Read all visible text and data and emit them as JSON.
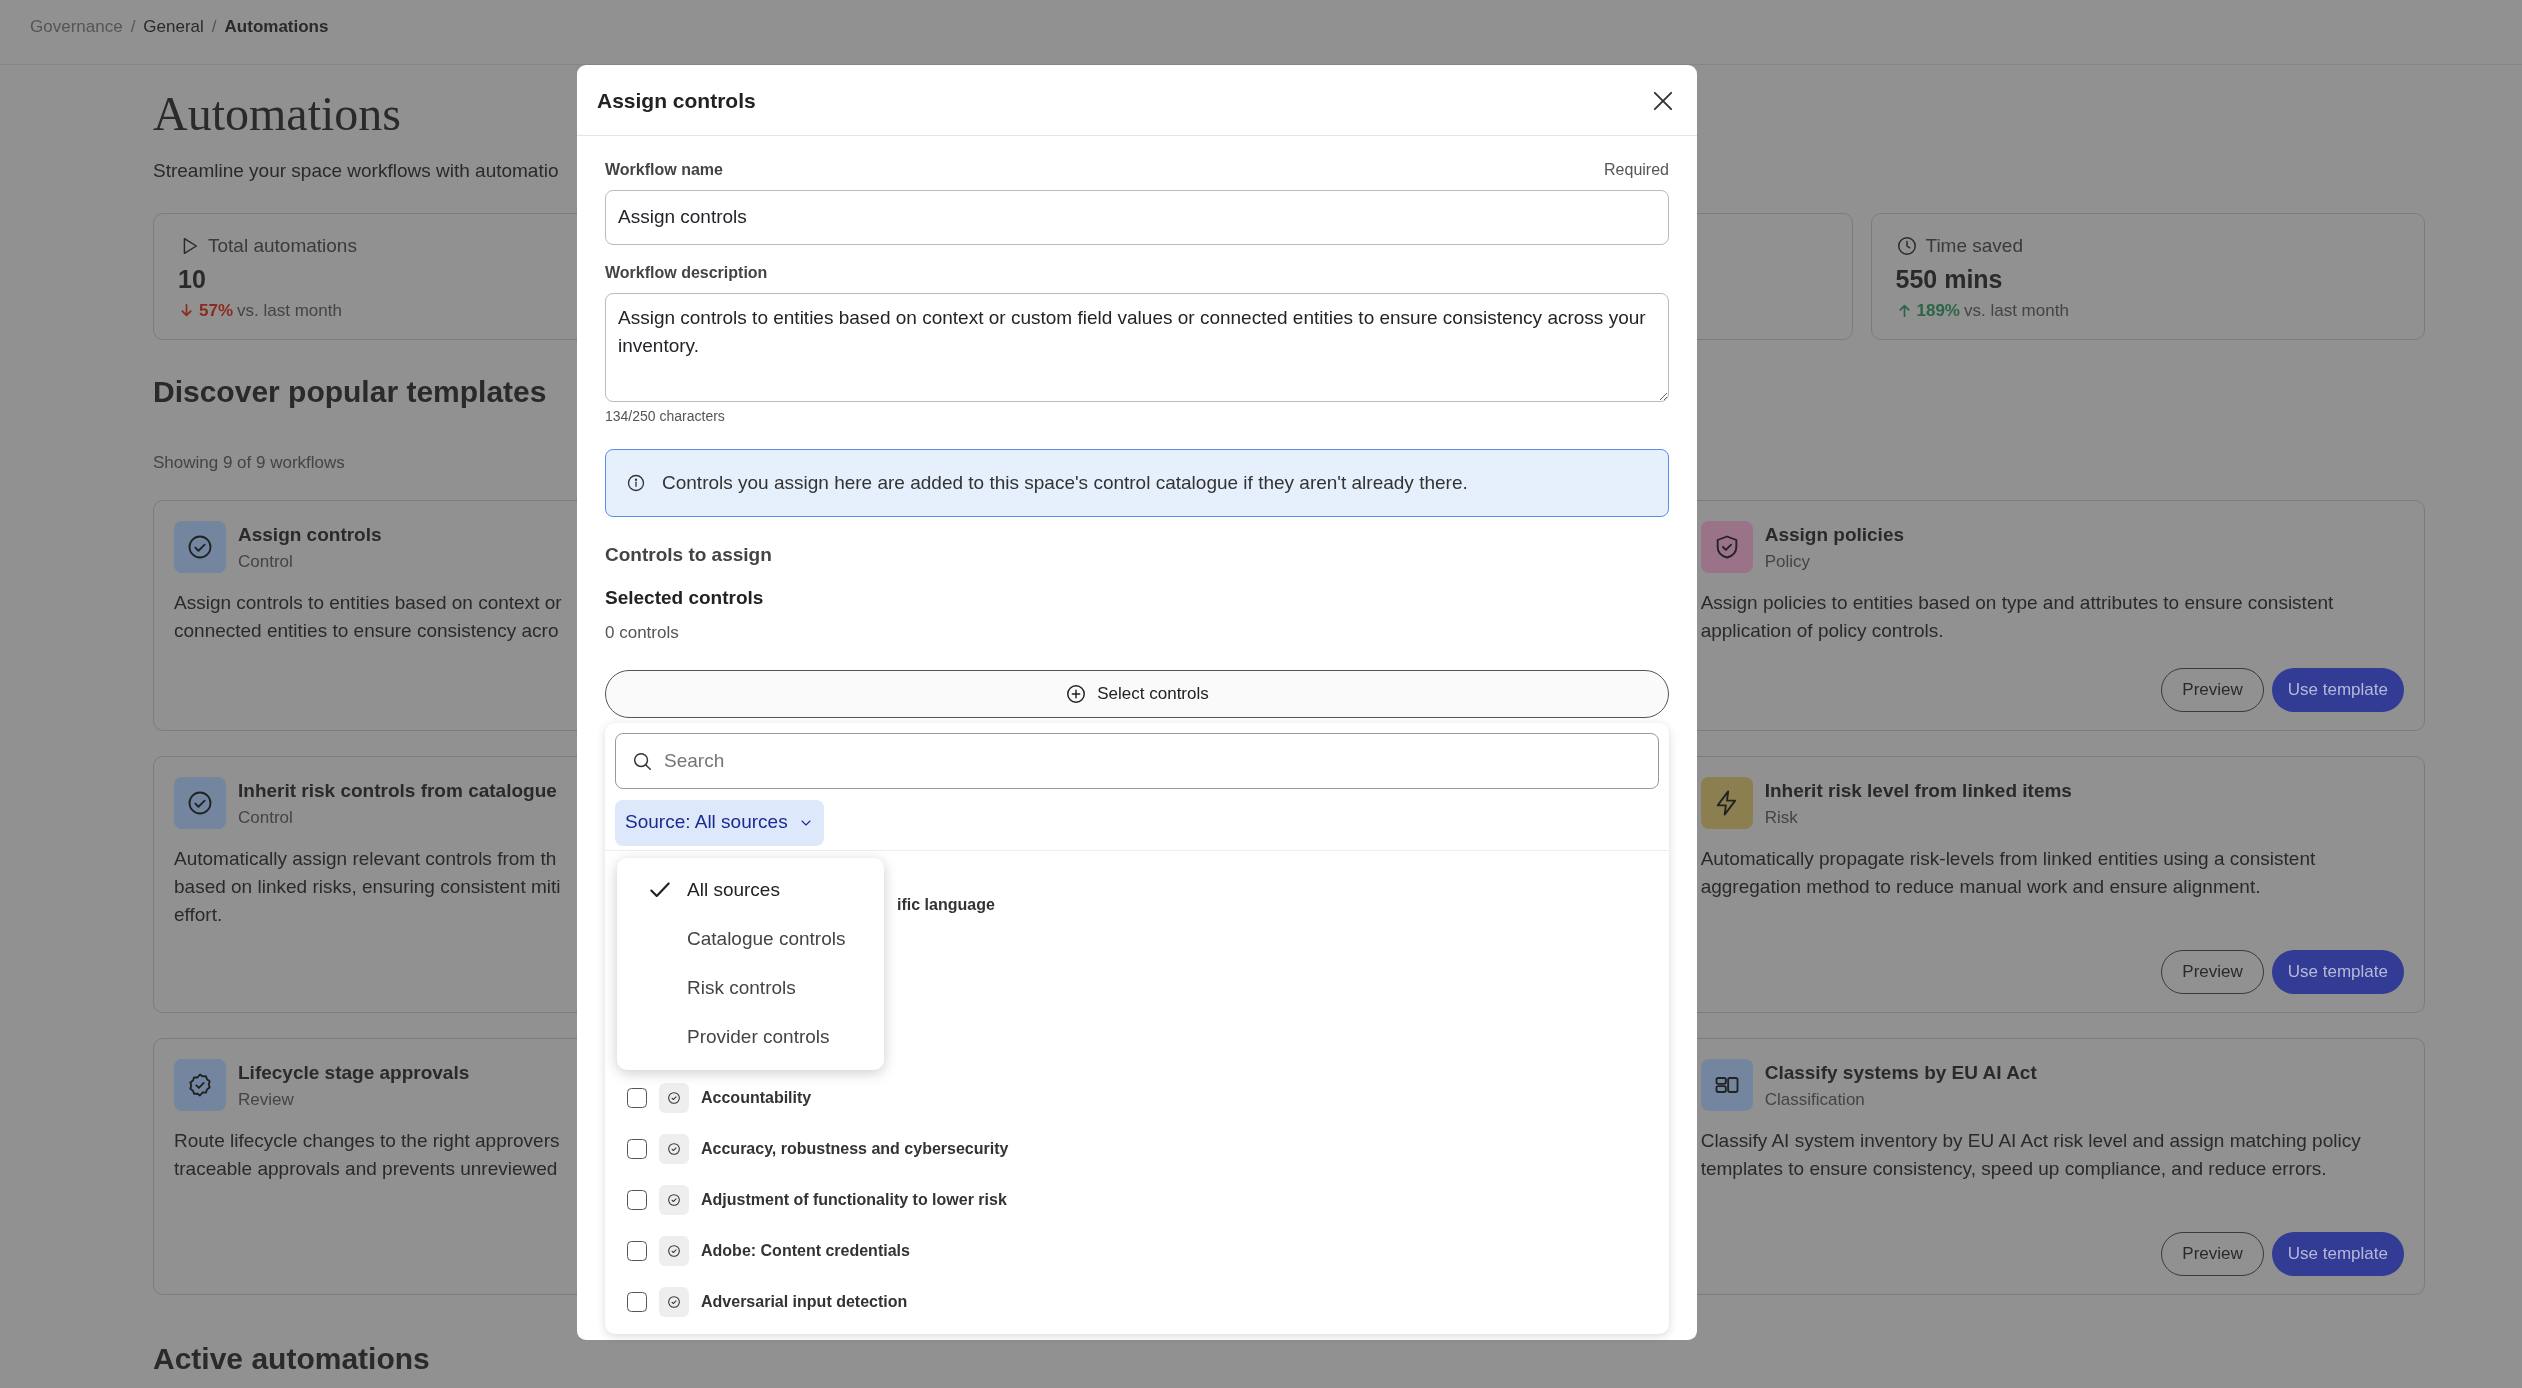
{
  "breadcrumb": [
    {
      "label": "Governance",
      "separator": "/",
      "muted": true,
      "current": false
    },
    {
      "label": "General",
      "separator": "/",
      "muted": false,
      "current": false
    },
    {
      "label": "Automations",
      "muted": false,
      "current": true
    }
  ],
  "page": {
    "title": "Automations",
    "subtitle": "Streamline your space workflows with automatio"
  },
  "stats": [
    {
      "kind": "count",
      "label": "Total automations",
      "value": "10",
      "increase": false,
      "change": "57%",
      "comparison": "vs. last month"
    },
    {
      "kind": "time",
      "label": "Time saved",
      "value": "550 mins",
      "increase": true,
      "change": "189%",
      "comparison": "vs. last month"
    }
  ],
  "templates": {
    "title": "Discover popular templates",
    "count": "Showing 9 of 9 workflows",
    "left_cards": [
      {
        "kind": "control",
        "color": "#74869f",
        "title": "Assign controls",
        "category": "Control",
        "description_lines": [
          "Assign controls to entities based on context or",
          "connected entities to ensure consistency acro"
        ]
      },
      {
        "kind": "control",
        "color": "#74869f",
        "title": "Inherit risk controls from catalogue",
        "category": "Control",
        "description_lines": [
          "Automatically assign relevant controls from th",
          "based on linked risks, ensuring consistent miti",
          "effort."
        ]
      },
      {
        "kind": "review",
        "color": "#74869f",
        "title": "Lifecycle stage approvals",
        "category": "Review",
        "description_lines": [
          "Route lifecycle changes to the right approvers",
          "traceable approvals and prevents unreviewed"
        ]
      }
    ],
    "right_cards": [
      {
        "kind": "policy",
        "color": "#9a7388",
        "title": "Assign policies",
        "category": "Policy",
        "description_lines": [
          "Assign policies to entities based on type and attributes to ensure consistent application of policy controls."
        ],
        "buttons": [
          "Preview",
          "Use template"
        ]
      },
      {
        "kind": "risk",
        "color": "#8b7f4f",
        "title": "Inherit risk level from linked items",
        "category": "Risk",
        "description_lines": [
          "Automatically propagate risk-levels from linked entities using a consistent aggregation method to reduce manual work and ensure alignment."
        ],
        "buttons": [
          "Preview",
          "Use template"
        ]
      },
      {
        "kind": "classification",
        "color": "#74869f",
        "title": "Classify systems by EU AI Act",
        "category": "Classification",
        "description_lines": [
          "Classify AI system inventory by EU AI Act risk level and assign matching policy templates to ensure consistency, speed up compliance, and reduce errors."
        ],
        "buttons": [
          "Preview",
          "Use template"
        ]
      }
    ]
  },
  "active_title": "Active automations",
  "modal": {
    "title": "Assign controls",
    "name_field": {
      "label": "Workflow name",
      "hint": "Required",
      "value": "Assign controls"
    },
    "description_field": {
      "label": "Workflow description",
      "value": "Assign controls to entities based on context or custom field values or connected entities to ensure consistency across your inventory.",
      "counter": "134/250 characters"
    },
    "info": "Controls you assign here are added to this space's control catalogue if they aren't already there.",
    "section_title": "Controls to assign",
    "selected_title": "Selected controls",
    "selected_count": "0 controls",
    "select_button": "Select controls",
    "picker": {
      "search": {
        "placeholder": "Search"
      },
      "filter": "Source: All sources",
      "options": [
        {
          "label": "All sources",
          "selected": true
        },
        {
          "label": "Catalogue controls",
          "selected": false
        },
        {
          "label": "Risk controls",
          "selected": false
        },
        {
          "label": "Provider controls",
          "selected": false
        }
      ],
      "controls": [
        {
          "kind": "covered",
          "name": "ific language"
        },
        {
          "kind": "control",
          "name": "Accountability",
          "checked": false
        },
        {
          "kind": "control",
          "name": "Accuracy, robustness and cybersecurity",
          "checked": false
        },
        {
          "kind": "control",
          "name": "Adjustment of functionality to lower risk",
          "checked": false
        },
        {
          "kind": "control",
          "name": "Adobe: Content credentials",
          "checked": false
        },
        {
          "kind": "control",
          "name": "Adversarial input detection",
          "checked": false
        }
      ]
    }
  }
}
